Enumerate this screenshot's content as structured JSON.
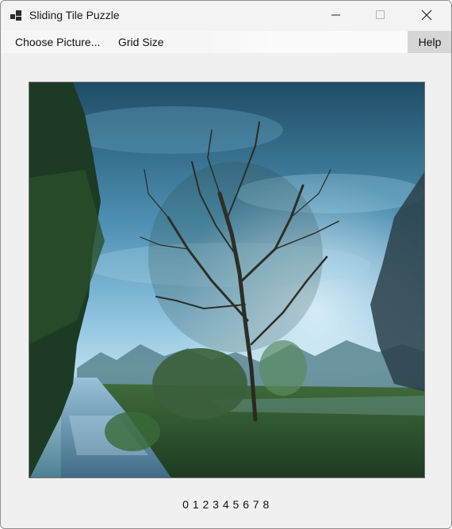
{
  "window": {
    "title": "Sliding Tile Puzzle"
  },
  "icons": {
    "app": "puzzle-app-icon",
    "minimize": "minimize-icon",
    "maximize": "maximize-icon",
    "close": "close-icon"
  },
  "menu": {
    "choose_picture": "Choose Picture...",
    "grid_size": "Grid Size",
    "help": "Help"
  },
  "puzzle": {
    "tile_order": "0 1 2 3 4 5 6 7 8"
  },
  "colors": {
    "menu_highlight": "#d6d6d6",
    "window_bg": "#f0f0f0"
  }
}
